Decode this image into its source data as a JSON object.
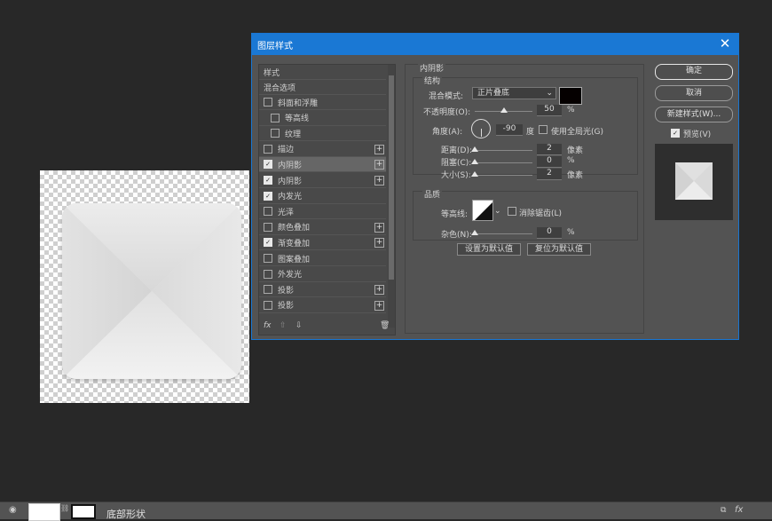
{
  "dialog": {
    "title": "图层样式",
    "styles_header": "样式",
    "blend_options": "混合选项",
    "items": [
      {
        "label": "斜面和浮雕",
        "checked": false,
        "plus": false,
        "indent": false
      },
      {
        "label": "等高线",
        "checked": false,
        "plus": false,
        "indent": true
      },
      {
        "label": "纹理",
        "checked": false,
        "plus": false,
        "indent": true
      },
      {
        "label": "描边",
        "checked": false,
        "plus": true,
        "indent": false
      },
      {
        "label": "内阴影",
        "checked": true,
        "plus": true,
        "indent": false,
        "selected": true
      },
      {
        "label": "内阴影",
        "checked": true,
        "plus": true,
        "indent": false
      },
      {
        "label": "内发光",
        "checked": true,
        "plus": false,
        "indent": false
      },
      {
        "label": "光泽",
        "checked": false,
        "plus": false,
        "indent": false
      },
      {
        "label": "颜色叠加",
        "checked": false,
        "plus": true,
        "indent": false
      },
      {
        "label": "渐变叠加",
        "checked": true,
        "plus": true,
        "indent": false
      },
      {
        "label": "图案叠加",
        "checked": false,
        "plus": false,
        "indent": false
      },
      {
        "label": "外发光",
        "checked": false,
        "plus": false,
        "indent": false
      },
      {
        "label": "投影",
        "checked": false,
        "plus": true,
        "indent": false
      },
      {
        "label": "投影",
        "checked": false,
        "plus": true,
        "indent": false
      }
    ],
    "footer_fx": "fx"
  },
  "inner_shadow": {
    "section_title": "内阴影",
    "structure_title": "结构",
    "blend_mode_label": "混合模式:",
    "blend_mode_value": "正片叠底",
    "shadow_color": "#050000",
    "opacity_label": "不透明度(O):",
    "opacity_value": "50",
    "opacity_unit": "%",
    "angle_label": "角度(A):",
    "angle_value": "-90",
    "angle_unit": "度",
    "global_light_label": "使用全局光(G)",
    "distance_label": "距离(D):",
    "distance_value": "2",
    "distance_unit": "像素",
    "choke_label": "阻塞(C):",
    "choke_value": "0",
    "choke_unit": "%",
    "size_label": "大小(S):",
    "size_value": "2",
    "size_unit": "像素",
    "quality_title": "品质",
    "contour_label": "等高线:",
    "antialias_label": "消除锯齿(L)",
    "noise_label": "杂色(N):",
    "noise_value": "0",
    "noise_unit": "%",
    "set_default": "设置为默认值",
    "reset_default": "复位为默认值"
  },
  "sliders": {
    "opacity": 0.5,
    "distance": 0.0,
    "choke": 0.0,
    "size": 0.0,
    "noise": 0.0
  },
  "right": {
    "ok": "确定",
    "cancel": "取消",
    "new_style": "新建样式(W)...",
    "preview": "预览(V)"
  },
  "layers": {
    "layer_name": "底部形状"
  }
}
